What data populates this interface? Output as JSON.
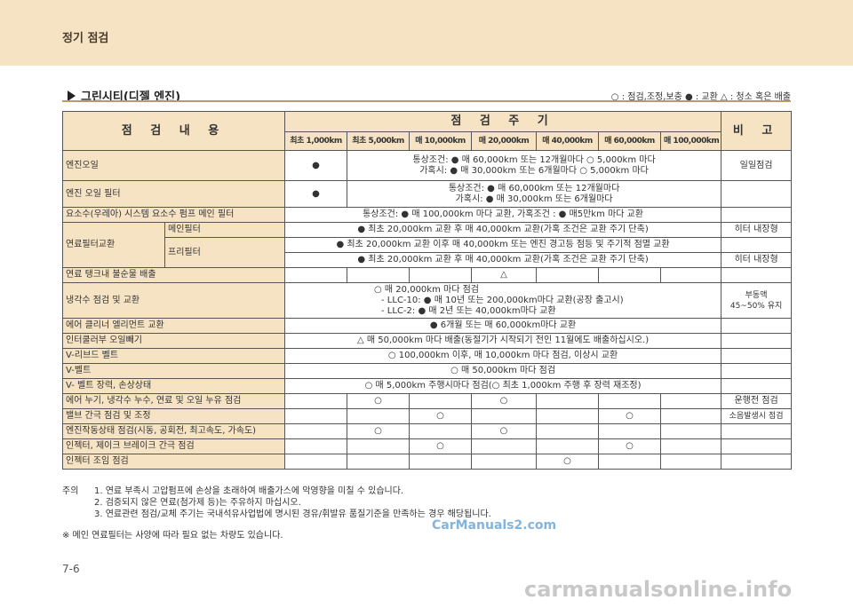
{
  "header": {
    "title": "정기 점검"
  },
  "section": {
    "title": "그린시티(디젤 엔진)",
    "legend": "○ : 점검,조정,보충   ● : 교환   △ : 청소 혹은 배출"
  },
  "table": {
    "col_item": "점 검 내 용",
    "col_period": "점 검 주 기",
    "col_note": "비 고",
    "sub_cols": [
      "최초 1,000km",
      "최초 5,000km",
      "매 10,000km",
      "매 20,000km",
      "매 40,000km",
      "매 60,000km",
      "매 100,000km"
    ],
    "rows": {
      "engine_oil": {
        "name": "엔진오일",
        "mark": "●",
        "cond1": "통상조건: ● 매 60,000km 또는 12개월마다 ○ 5,000km 마다",
        "cond2": "가혹시: ● 매 30,000km 또는 6개월마다 ○ 5,000km 마다",
        "note": "일일점검"
      },
      "oil_filter": {
        "name": "엔진 오일 필터",
        "mark": "●",
        "cond1": "통상조건: ● 매 60,000km 또는 12개월마다",
        "cond2": "가혹시: ● 매 30,000km 또는 6개월마다"
      },
      "urea": {
        "name": "요소수(우레아) 시스템 요소수 펌프 메인 필터",
        "text": "통상조건: ● 매 100,000km 마다 교환, 가혹조건 : ● 매5만km 마다 교환"
      },
      "fuel_filter": {
        "name": "연료필터교환",
        "main_label": "메인필터",
        "main_text": "● 최초 20,000km 교환 후 매 40,000km 교환(가혹 조건은 교환 주기 단축)",
        "main_note": "히터 내장형",
        "pre_label": "프리필터",
        "pre_text1": "● 최초 20,000km 교환 이후 매 40,000km 또는 엔진 경고등 점등 및 주기적 점멸 교환",
        "pre_text2": "● 최초 20,000km 교환 후 매 40,000km 교환(가혹 조건은 교환 주기 단축)",
        "pre_note": "히터 내장형"
      },
      "fuel_tank": {
        "name": "연료 탱크내 불순물 배출",
        "mark": "△"
      },
      "coolant": {
        "name": "냉각수 점검 및 교환",
        "l1": "○ 매 20,000km 마다 점검",
        "l2": "- LLC-10: ● 매 10년 또는 200,000km마다 교환(공장 출고시)",
        "l3": "- LLC-2: ● 매 2년 또는 40,000km마다 교환",
        "note1": "부동액",
        "note2": "45~50% 유지"
      },
      "air_cleaner": {
        "name": "에어 클리너 엘리먼트 교환",
        "text": "● 6개월 또는 매 60,000km마다 교환"
      },
      "intercooler": {
        "name": "인터쿨러부 오일빼기",
        "text": "△ 매 50,000km 마다 배출(동절기가 시작되기 전인 11월에도 배출하십시오.)"
      },
      "v_ribbed": {
        "name": "V-리브드 벨트",
        "text": "○ 100,000km 이후, 매 10,000km 마다 점검, 이상시 교환"
      },
      "v_belt": {
        "name": "V-벨트",
        "text": "○ 매 50,000km 마다 점검"
      },
      "v_belt_tension": {
        "name": "V- 벨트 장력, 손상상태",
        "text": "○ 매 5,000km 주행시마다 점검(○ 최초 1,000km 주행 후 장력 재조정)"
      },
      "leak": {
        "name": "에어 누기, 냉각수 누수, 연료 및 오일 누유 점검",
        "m1": "○",
        "m2": "○",
        "note": "운행전 점검"
      },
      "valve": {
        "name": "밸브 간극 점검 및 조정",
        "m1": "○",
        "m2": "○",
        "note": "소음발생시 점검"
      },
      "engine_state": {
        "name": "엔진작동상태 점검(시동, 공회전, 최고속도, 가속도)",
        "m1": "○",
        "m2": "○"
      },
      "injector": {
        "name": "인젝터, 제이크 브레이크 간극 점검",
        "m1": "○",
        "m2": "○"
      },
      "injector_torque": {
        "name": "인젝터 조임 점검",
        "m1": "○"
      }
    }
  },
  "footnotes": {
    "label": "주의",
    "items": [
      "1. 연료 부족시 고압펌프에 손상을 초래하여 배출가스에 악영향을 미칠 수 있습니다.",
      "2. 검증되지 않은 연료(첨가제 등)는 주유하지 마십시오.",
      "3. 연료관련 점검/교체 주기는 국내석유사업법에 명시된 경유/휘발유 품질기준을 만족하는 경우 해당됩니다."
    ],
    "extra": "※ 메인 연료필터는 사양에 따라 필요 없는 차량도 있습니다."
  },
  "watermark": "CarManuals2.com",
  "watermark2": "carmanualsonline.info",
  "page_number": "7-6"
}
